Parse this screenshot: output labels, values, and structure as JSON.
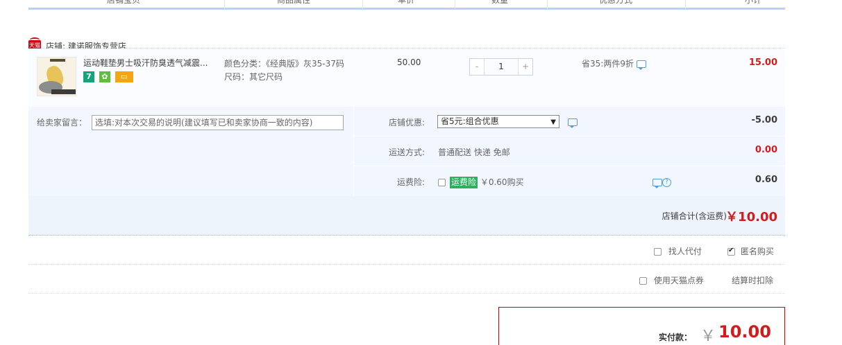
{
  "header": {
    "cols": [
      "店铺宝贝",
      "商品属性",
      "单价",
      "数量",
      "优惠方式",
      "小计"
    ]
  },
  "shop": {
    "logo_text": "天猫",
    "name": "店铺: 建诺服饰专营店"
  },
  "item": {
    "title": "运动鞋垫男士吸汗防臭透气减震...",
    "badges": [
      "7",
      "✿",
      "▭"
    ],
    "attr_color": "颜色分类：《经典版》灰35-37码",
    "attr_size": "尺码：其它尺码",
    "price": "50.00",
    "qty_minus": "-",
    "qty": "1",
    "qty_plus": "+",
    "promo": "省35:两件9折",
    "subtotal": "15.00"
  },
  "extra": {
    "msg_label": "给卖家留言：",
    "msg_placeholder": "选填:对本次交易的说明(建议填写已和卖家协商一致的内容)",
    "discount_label": "店铺优惠:",
    "discount_selected": "省5元:组合优惠",
    "discount_amount": "-5.00",
    "shipping_label": "运送方式:",
    "shipping_value": "普通配送 快递 免邮",
    "shipping_amount": "0.00",
    "insurance_label": "运费险:",
    "insurance_tag": "运费险",
    "insurance_price": "￥0.60购买",
    "insurance_amount": "0.60"
  },
  "total": {
    "label": "店铺合计(含运费)",
    "amount": "￥10.00"
  },
  "options": {
    "find_pay": "找人代付",
    "anonymous": "匿名购买",
    "tmall_points": "使用天猫点券",
    "settle_deduct": "结算时扣除"
  },
  "pay": {
    "label": "实付款：",
    "currency": "￥",
    "amount": "10.00"
  },
  "colors": {
    "price_red": "#d21c1c",
    "tmall_red": "#d8000f",
    "header_blue": "#b2d1ff",
    "panel_blue": "#f2f7ff"
  }
}
